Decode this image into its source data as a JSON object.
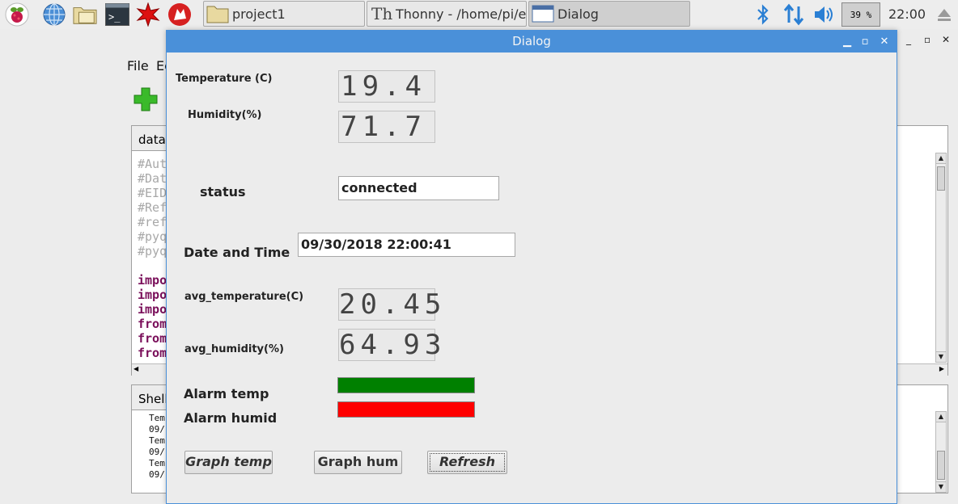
{
  "taskbar": {
    "tasks": [
      {
        "label": "project1"
      },
      {
        "label": "Thonny  -  /home/pi/e..."
      },
      {
        "label": "Dialog"
      }
    ],
    "cpu": "39 %",
    "clock": "22:00"
  },
  "thonny": {
    "menu_file": "File",
    "menu_edit": "Ec",
    "editor_tab": "data.",
    "code_lines": [
      "#Aut",
      "#Dat",
      "#EID",
      "#Ref",
      "#ref",
      "#pyq",
      "#pyq",
      "",
      "impo",
      "impo",
      "impo",
      "from",
      "from",
      "from"
    ],
    "shell_tab": "Shell",
    "shell_lines": [
      "Tem",
      "09/",
      "Tem",
      "09/",
      "Tem",
      "09/"
    ]
  },
  "dialog": {
    "title": "Dialog",
    "temperature_label": "Temperature (C)",
    "temperature_value": "19.4",
    "humidity_label": "Humidity(%)",
    "humidity_value": "71.7",
    "status_label": "status",
    "status_value": "connected",
    "datetime_label": "Date and Time",
    "datetime_value": "09/30/2018 22:00:41",
    "avg_temp_label": "avg_temperature(C)",
    "avg_temp_value": "20.45",
    "avg_hum_label": "avg_humidity(%)",
    "avg_hum_value": "64.93",
    "alarm_temp_label": "Alarm temp",
    "alarm_hum_label": "Alarm humid",
    "alarm_temp_color": "#008000",
    "alarm_hum_color": "#ff0000",
    "graph_temp_btn": "Graph temp",
    "graph_hum_btn": "Graph hum",
    "refresh_btn": "Refresh"
  }
}
